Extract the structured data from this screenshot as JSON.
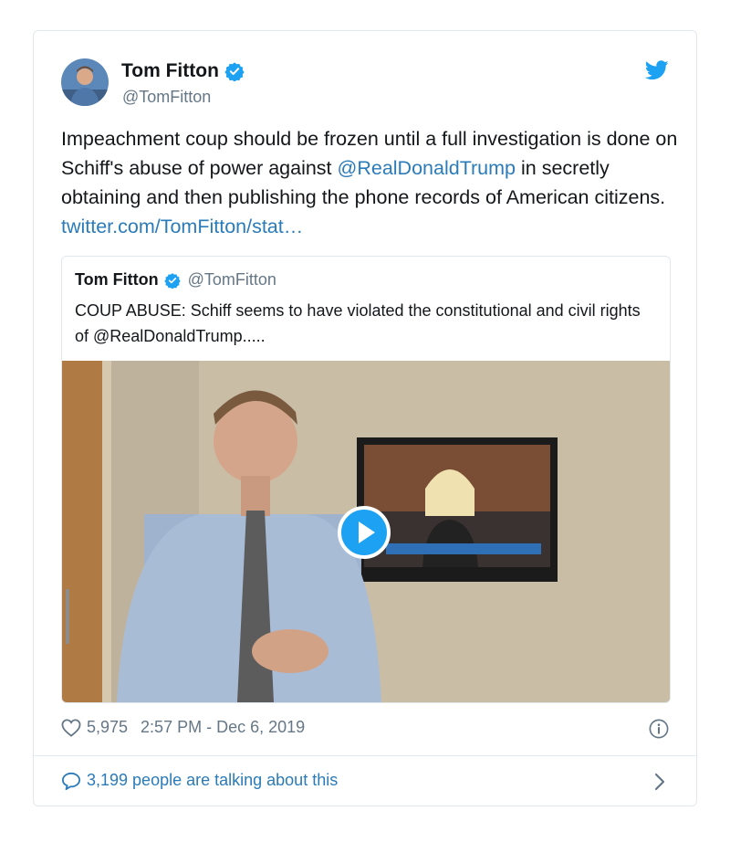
{
  "tweet": {
    "display_name": "Tom Fitton",
    "handle": "@TomFitton",
    "text_parts": {
      "before_mention": "Impeachment coup should be frozen until a full investigation is done on Schiff's abuse of power against ",
      "mention": "@RealDonaldTrump",
      "after_mention": " in secretly obtaining and then publishing the phone records of American citizens. ",
      "link": "twitter.com/TomFitton/stat…"
    },
    "likes": "5,975",
    "timestamp": "2:57 PM - Dec 6, 2019",
    "talking": "3,199 people are talking about this"
  },
  "quoted_tweet": {
    "display_name": "Tom Fitton",
    "handle": "@TomFitton",
    "text": "COUP ABUSE: Schiff seems to have violated the constitutional and civil rights of @RealDonaldTrump....."
  },
  "colors": {
    "link": "#2b7bb9",
    "verified": "#1da1f2",
    "muted": "#657786",
    "border": "#e1e8ed"
  },
  "icons": {
    "verified": "verified-badge-icon",
    "brand": "twitter-bird-icon",
    "like": "heart-icon",
    "info": "info-icon",
    "reply": "speech-bubble-icon",
    "chevron": "chevron-right-icon",
    "play": "play-icon"
  }
}
